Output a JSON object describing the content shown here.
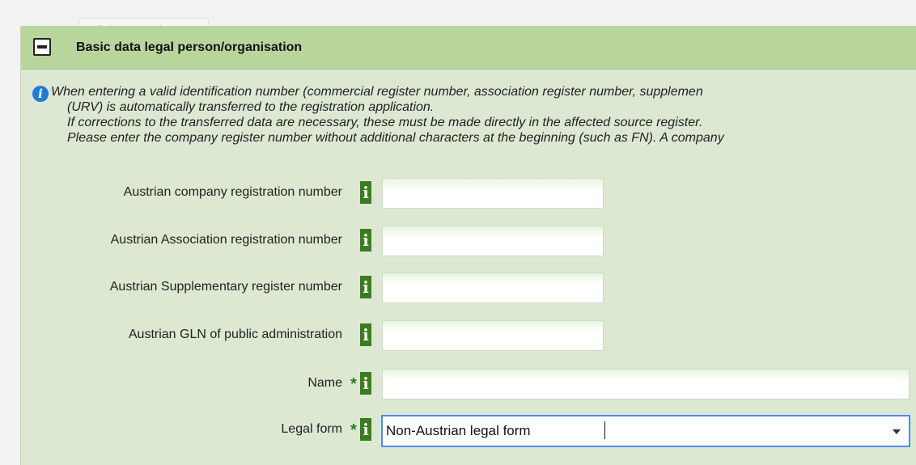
{
  "ghost": {
    "label": "Collapse block"
  },
  "section": {
    "title": "Basic data legal person/organisation"
  },
  "notice": {
    "lines": [
      "When entering a valid identification number (commercial register number, association register number, supplemen",
      "(URV) is automatically transferred to the registration application.",
      "If corrections to the transferred data are necessary, these must be made directly in the affected source register.",
      "Please enter the company register number without additional characters at the beginning (such as FN). A company"
    ]
  },
  "fields": {
    "company_reg": {
      "label": "Austrian company registration number",
      "value": ""
    },
    "association_reg": {
      "label": "Austrian Association registration number",
      "value": ""
    },
    "supplementary_reg": {
      "label": "Austrian Supplementary register number",
      "value": ""
    },
    "gln": {
      "label": "Austrian GLN of public administration",
      "value": ""
    },
    "name": {
      "label": "Name",
      "value": "",
      "required_mark": "*"
    },
    "legal_form": {
      "label": "Legal form",
      "selected": "Non-Austrian legal form",
      "required_mark": "*"
    }
  },
  "icons": {
    "info_badge": "i",
    "info_circle": "i"
  },
  "colors": {
    "header": "#b8d69c",
    "panel": "#dde8d3",
    "info_badge": "#3a7d1c",
    "focus": "#4a8de3"
  }
}
